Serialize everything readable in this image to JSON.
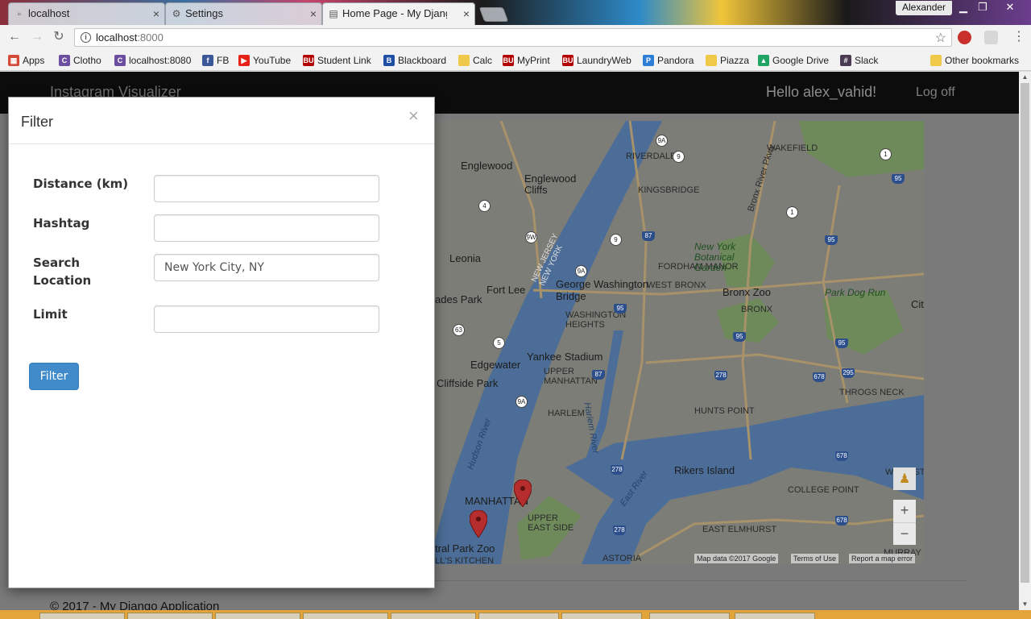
{
  "browser": {
    "tabs": [
      {
        "label": "localhost",
        "icon": "page-icon",
        "active": false
      },
      {
        "label": "Settings",
        "icon": "gear-icon",
        "active": false
      },
      {
        "label": "Home Page - My Django",
        "icon": "document-icon",
        "active": true
      }
    ],
    "profile_name": "Alexander",
    "url_host": "localhost",
    "url_port": ":8000",
    "bookmarks": [
      {
        "label": "Apps",
        "icon": "apps-grid-icon",
        "color": "#d44b3a"
      },
      {
        "label": "Clotho",
        "icon": "clotho-icon",
        "color": "#6b4ea0"
      },
      {
        "label": "localhost:8080",
        "icon": "clotho-icon",
        "color": "#6b4ea0"
      },
      {
        "label": "FB",
        "icon": "facebook-icon",
        "color": "#3b5998"
      },
      {
        "label": "YouTube",
        "icon": "youtube-icon",
        "color": "#e62117"
      },
      {
        "label": "Student Link",
        "icon": "bu-icon",
        "color": "#b30000"
      },
      {
        "label": "Blackboard",
        "icon": "blackboard-icon",
        "color": "#1e4fa3"
      },
      {
        "label": "Calc",
        "icon": "folder-icon",
        "color": "#f0c94a"
      },
      {
        "label": "MyPrint",
        "icon": "bu-icon",
        "color": "#b30000"
      },
      {
        "label": "LaundryWeb",
        "icon": "bu-icon",
        "color": "#b30000"
      },
      {
        "label": "Pandora",
        "icon": "pandora-icon",
        "color": "#2c7ed6"
      },
      {
        "label": "Piazza",
        "icon": "folder-icon",
        "color": "#f0c94a"
      },
      {
        "label": "Google Drive",
        "icon": "google-drive-icon",
        "color": "#1fa463"
      },
      {
        "label": "Slack",
        "icon": "slack-icon",
        "color": "#4a3b52"
      },
      {
        "label": "Other bookmarks",
        "icon": "folder-icon",
        "color": "#f0c94a"
      }
    ]
  },
  "site": {
    "brand": "Instagram Visualizer",
    "greeting": "Hello alex_vahid!",
    "logoff": "Log off",
    "footer": "© 2017 - My Django Application"
  },
  "map": {
    "labels": {
      "englewood": "Englewood",
      "englewood_cliffs": "Englewood Cliffs",
      "riverdale": "RIVERDALE",
      "kingsbridge": "KINGSBRIDGE",
      "wakefield": "WAKEFIELD",
      "leonia": "Leonia",
      "fort_lee": "Fort Lee",
      "gw_bridge": "George Washington Bridge",
      "fordham": "FORDHAM MANOR",
      "west_bronx": "WEST BRONX",
      "nybg": "New York Botanical Garden",
      "bronx_zoo": "Bronx Zoo",
      "park_dog_run": "Park Dog Run",
      "bronx": "BRONX",
      "wash_heights": "WASHINGTON HEIGHTS",
      "yankee_stadium": "Yankee Stadium",
      "edgewater": "Edgewater",
      "cliffside_park": "Cliffside Park",
      "upper_manhattan": "UPPER MANHATTAN",
      "harlem": "HARLEM",
      "hunts_point": "HUNTS POINT",
      "throgs_neck": "THROGS NECK",
      "rikers": "Rikers Island",
      "manhattan": "MANHATTAN",
      "upper_east_side": "UPPER EAST SIDE",
      "central_park_zoo": "tral Park Zoo",
      "college_point": "COLLEGE POINT",
      "east_elmhurst": "EAST ELMHURST",
      "astoria": "ASTORIA",
      "hells_kitchen": "LL'S KITCHEN",
      "hudson_river": "Hudson River",
      "harlem_river": "Harlem River",
      "east_river": "East River",
      "bronx_river_pkwy": "Bronx River Pkwy",
      "partial_cit": "Cit",
      "whitestone": "WHITEST",
      "murray_hill": "MURRAY HILL",
      "ades_park": "ades Park",
      "new_jersey_ny": "NEW JERSEY NEW YORK"
    },
    "attribution": "Map data ©2017 Google",
    "terms": "Terms of Use",
    "report": "Report a map error",
    "zoom_in": "+",
    "zoom_out": "−"
  },
  "filter_modal": {
    "title": "Filter",
    "close": "×",
    "fields": {
      "distance_label": "Distance (km)",
      "distance_value": "",
      "hashtag_label": "Hashtag",
      "hashtag_value": "",
      "location_label": "Search Location",
      "location_value": "New York City, NY",
      "limit_label": "Limit",
      "limit_value": ""
    },
    "submit": "Filter"
  },
  "colors": {
    "primary_button": "#428bca",
    "navbar": "#0c0c0c",
    "overlay_water": "#4b6d97",
    "overlay_land": "#7d7d78",
    "overlay_park": "#6e8a5a",
    "pin": "#b52d2d"
  }
}
